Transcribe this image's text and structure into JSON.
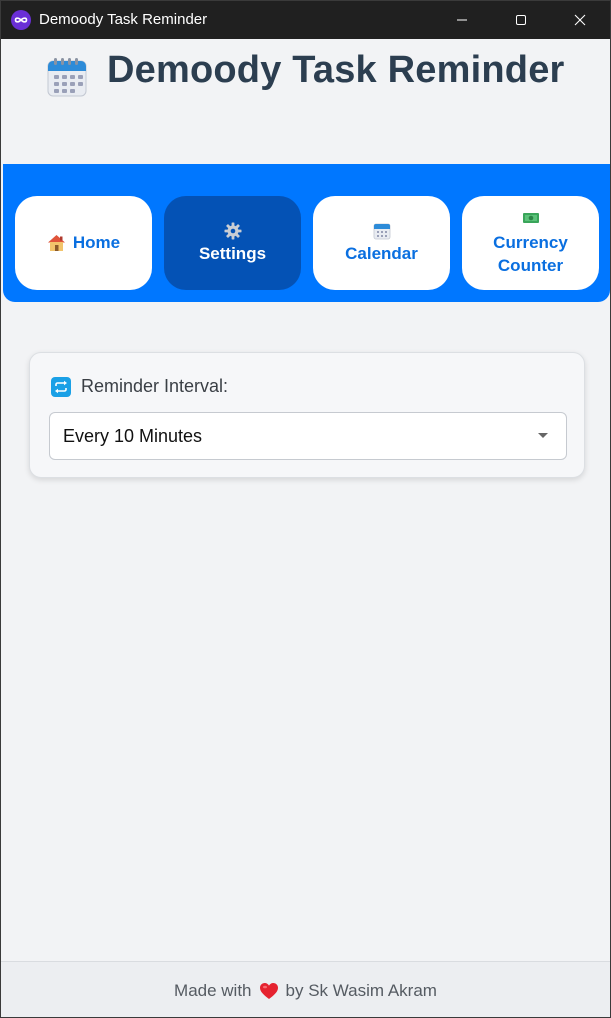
{
  "window": {
    "title": "Demoody Task Reminder",
    "app_icon": "infinity-icon",
    "controls": [
      "minimize-icon",
      "maximize-icon",
      "close-icon"
    ]
  },
  "header": {
    "icon": "calendar-icon",
    "title": "Demoody Task Reminder"
  },
  "nav": {
    "items": [
      {
        "label": "Home",
        "icon": "house-icon",
        "active": false
      },
      {
        "label": "Settings",
        "icon": "gear-icon",
        "active": true
      },
      {
        "label": "Calendar",
        "icon": "calendar-icon",
        "active": false
      },
      {
        "label": "Currency Counter",
        "icon": "money-icon",
        "active": false
      }
    ]
  },
  "settings": {
    "reminder_label": "Reminder Interval:",
    "reminder_icon": "repeat-icon",
    "reminder_value": "Every 10 Minutes"
  },
  "footer": {
    "prefix": "Made with",
    "icon": "heart-icon",
    "suffix": "by Sk Wasim Akram"
  },
  "colors": {
    "nav_background": "#0077ff",
    "nav_active": "#0452b5",
    "nav_text": "#0a6fe0",
    "title_text": "#2c3e50",
    "page_background": "#f2f3f5"
  }
}
